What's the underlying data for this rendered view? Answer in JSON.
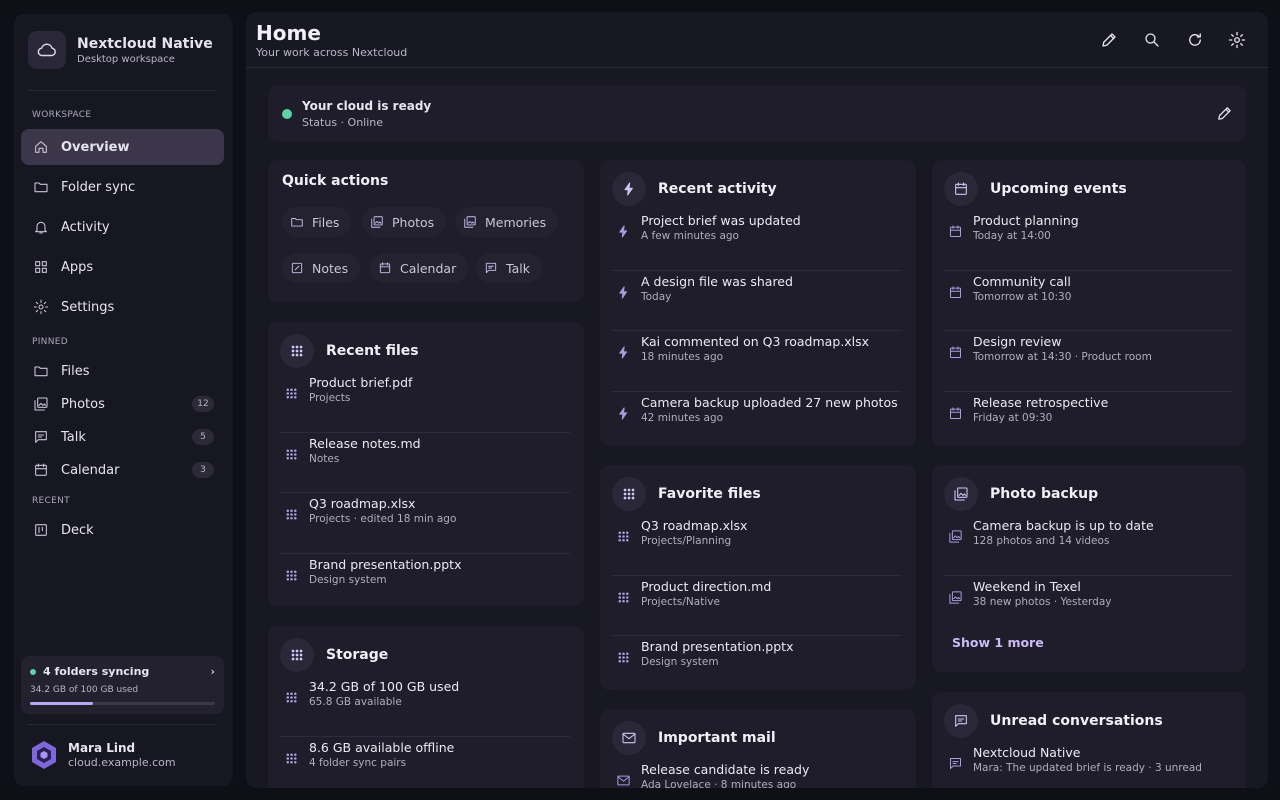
{
  "app": {
    "name": "Nextcloud Native",
    "subtitle": "Desktop workspace"
  },
  "sidebar": {
    "sections": {
      "workspace": "WORKSPACE",
      "pinned": "PINNED",
      "recent": "RECENT"
    },
    "nav": [
      {
        "label": "Overview",
        "icon": "home-icon",
        "active": true
      },
      {
        "label": "Folder sync",
        "icon": "folder-icon"
      },
      {
        "label": "Activity",
        "icon": "bell-icon"
      },
      {
        "label": "Apps",
        "icon": "apps-grid-icon"
      },
      {
        "label": "Settings",
        "icon": "gear-icon"
      }
    ],
    "pinned": [
      {
        "label": "Files",
        "icon": "folder-icon",
        "badge": ""
      },
      {
        "label": "Photos",
        "icon": "photos-icon",
        "badge": "12"
      },
      {
        "label": "Talk",
        "icon": "chat-icon",
        "badge": "5"
      },
      {
        "label": "Calendar",
        "icon": "calendar-icon",
        "badge": "3"
      }
    ],
    "recent": [
      {
        "label": "Deck",
        "icon": "deck-icon"
      }
    ],
    "sync": {
      "title": "4 folders syncing",
      "usage": "34.2 GB of 100 GB used",
      "progress": 0.342
    },
    "user": {
      "name": "Mara Lind",
      "host": "cloud.example.com"
    }
  },
  "header": {
    "title": "Home",
    "subtitle": "Your work across Nextcloud",
    "actions": [
      "edit-icon",
      "search-icon",
      "refresh-icon",
      "gear-icon"
    ]
  },
  "status": {
    "title": "Your cloud is ready",
    "subtitle": "Status · Online"
  },
  "quick_actions": {
    "title": "Quick actions",
    "items": [
      "Files",
      "Photos",
      "Memories",
      "Notes",
      "Calendar",
      "Talk"
    ]
  },
  "recent_files": {
    "title": "Recent files",
    "items": [
      {
        "title": "Product brief.pdf",
        "sub": "Projects"
      },
      {
        "title": "Release notes.md",
        "sub": "Notes"
      },
      {
        "title": "Q3 roadmap.xlsx",
        "sub": "Projects · edited 18 min ago"
      },
      {
        "title": "Brand presentation.pptx",
        "sub": "Design system"
      }
    ]
  },
  "storage": {
    "title": "Storage",
    "items": [
      {
        "title": "34.2 GB of 100 GB used",
        "sub": "65.8 GB available"
      },
      {
        "title": "8.6 GB available offline",
        "sub": "4 folder sync pairs"
      }
    ]
  },
  "recent_activity": {
    "title": "Recent activity",
    "items": [
      {
        "title": "Project brief was updated",
        "sub": "A few minutes ago"
      },
      {
        "title": "A design file was shared",
        "sub": "Today"
      },
      {
        "title": "Kai commented on Q3 roadmap.xlsx",
        "sub": "18 minutes ago"
      },
      {
        "title": "Camera backup uploaded 27 new photos",
        "sub": "42 minutes ago"
      }
    ]
  },
  "favorite_files": {
    "title": "Favorite files",
    "items": [
      {
        "title": "Q3 roadmap.xlsx",
        "sub": "Projects/Planning"
      },
      {
        "title": "Product direction.md",
        "sub": "Projects/Native"
      },
      {
        "title": "Brand presentation.pptx",
        "sub": "Design system"
      }
    ]
  },
  "important_mail": {
    "title": "Important mail",
    "items": [
      {
        "title": "Release candidate is ready",
        "sub": "Ada Lovelace · 8 minutes ago"
      }
    ]
  },
  "upcoming_events": {
    "title": "Upcoming events",
    "items": [
      {
        "title": "Product planning",
        "sub": "Today at 14:00"
      },
      {
        "title": "Community call",
        "sub": "Tomorrow at 10:30"
      },
      {
        "title": "Design review",
        "sub": "Tomorrow at 14:30 · Product room"
      },
      {
        "title": "Release retrospective",
        "sub": "Friday at 09:30"
      }
    ]
  },
  "photo_backup": {
    "title": "Photo backup",
    "items": [
      {
        "title": "Camera backup is up to date",
        "sub": "128 photos and 14 videos"
      },
      {
        "title": "Weekend in Texel",
        "sub": "38 new photos · Yesterday"
      }
    ],
    "show_more": "Show 1 more"
  },
  "unread_conversations": {
    "title": "Unread conversations",
    "items": [
      {
        "title": "Nextcloud Native",
        "sub": "Mara: The updated brief is ready · 3 unread"
      }
    ]
  },
  "colors": {
    "accent": "#b9a8ef",
    "online": "#5fd1a4",
    "background": "#0f0f18",
    "card": "#1e1d29"
  }
}
